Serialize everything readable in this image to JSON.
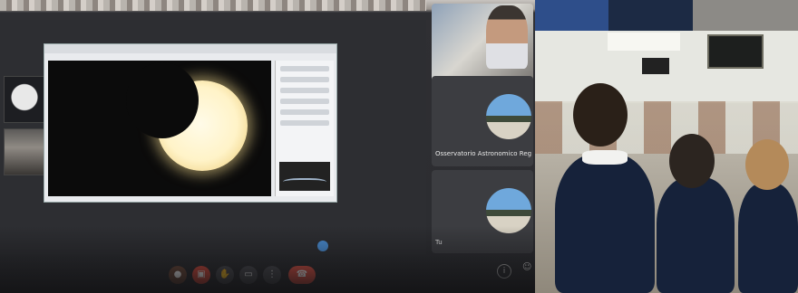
{
  "photos": {
    "left": {
      "label": "Projected video call showing a partial solar eclipse"
    },
    "right": {
      "label": "Classroom of children watching the broadcast"
    }
  },
  "participant_tiles": [
    {
      "name": "Osservatorio Astronomico Reg"
    },
    {
      "name": "Tu"
    }
  ],
  "toolbar_icons": [
    "mic-icon",
    "camera-off-icon",
    "raise-hand-icon",
    "present-icon",
    "more-options-icon",
    "hang-up-icon"
  ],
  "colors": {
    "hangup": "#e25446",
    "call_bg": "#2d2e32",
    "uniform": "#16223a"
  }
}
